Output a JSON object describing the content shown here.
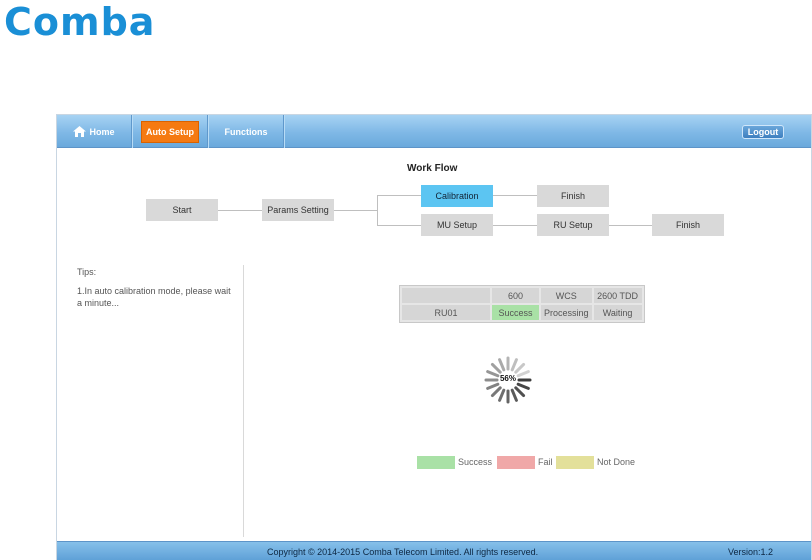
{
  "brand": {
    "logo_text": "Comba",
    "color": "#1a8fd6"
  },
  "nav": {
    "home": "Home",
    "auto_setup": "Auto Setup",
    "functions": "Functions",
    "logout": "Logout",
    "active_color": "#f57a12"
  },
  "workflow": {
    "title": "Work Flow",
    "start": "Start",
    "params": "Params Setting",
    "calibration": "Calibration",
    "finish_top": "Finish",
    "mu_setup": "MU Setup",
    "ru_setup": "RU Setup",
    "finish_bottom": "Finish",
    "active_color": "#5cc5f2"
  },
  "tips": {
    "title": "Tips:",
    "text": "1.In auto calibration mode, please wait a minute..."
  },
  "results": {
    "headers": [
      "",
      "600",
      "WCS",
      "2600 TDD"
    ],
    "rows": [
      [
        "RU01",
        "Success",
        "Processing",
        "Waiting"
      ]
    ]
  },
  "progress": {
    "percent_label": "56%",
    "value": 56
  },
  "legend": {
    "success": "Success",
    "fail": "Fail",
    "not_done": "Not Done",
    "success_color": "#a9e1a6",
    "fail_color": "#f0a8a8",
    "not_done_color": "#e3e09a"
  },
  "footer": {
    "copyright": "Copyright © 2014-2015 Comba Telecom Limited. All rights reserved.",
    "version": "Version:1.2"
  }
}
